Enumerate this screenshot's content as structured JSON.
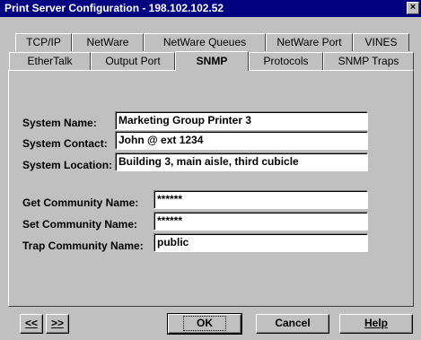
{
  "window": {
    "title": "Print Server Configuration - 198.102.102.52",
    "close_glyph": "×"
  },
  "tabs_row1": [
    "TCP/IP",
    "NetWare",
    "NetWare Queues",
    "NetWare Port",
    "VINES"
  ],
  "tabs_row2": [
    "EtherTalk",
    "Output Port",
    "SNMP",
    "Protocols",
    "SNMP Traps"
  ],
  "selected_tab": "SNMP",
  "form": {
    "system_name_label": "System Name:",
    "system_name_value": "Marketing Group Printer 3",
    "system_contact_label": "System Contact:",
    "system_contact_value": "John @ ext 1234",
    "system_location_label": "System Location:",
    "system_location_value": "Building 3, main aisle, third cubicle",
    "get_community_label": "Get Community Name:",
    "get_community_value": "******",
    "set_community_label": "Set Community Name:",
    "set_community_value": "******",
    "trap_community_label": "Trap Community Name:",
    "trap_community_value": "public"
  },
  "buttons": {
    "prev": "<<",
    "next": ">>",
    "ok": "OK",
    "cancel": "Cancel",
    "help": "Help"
  }
}
